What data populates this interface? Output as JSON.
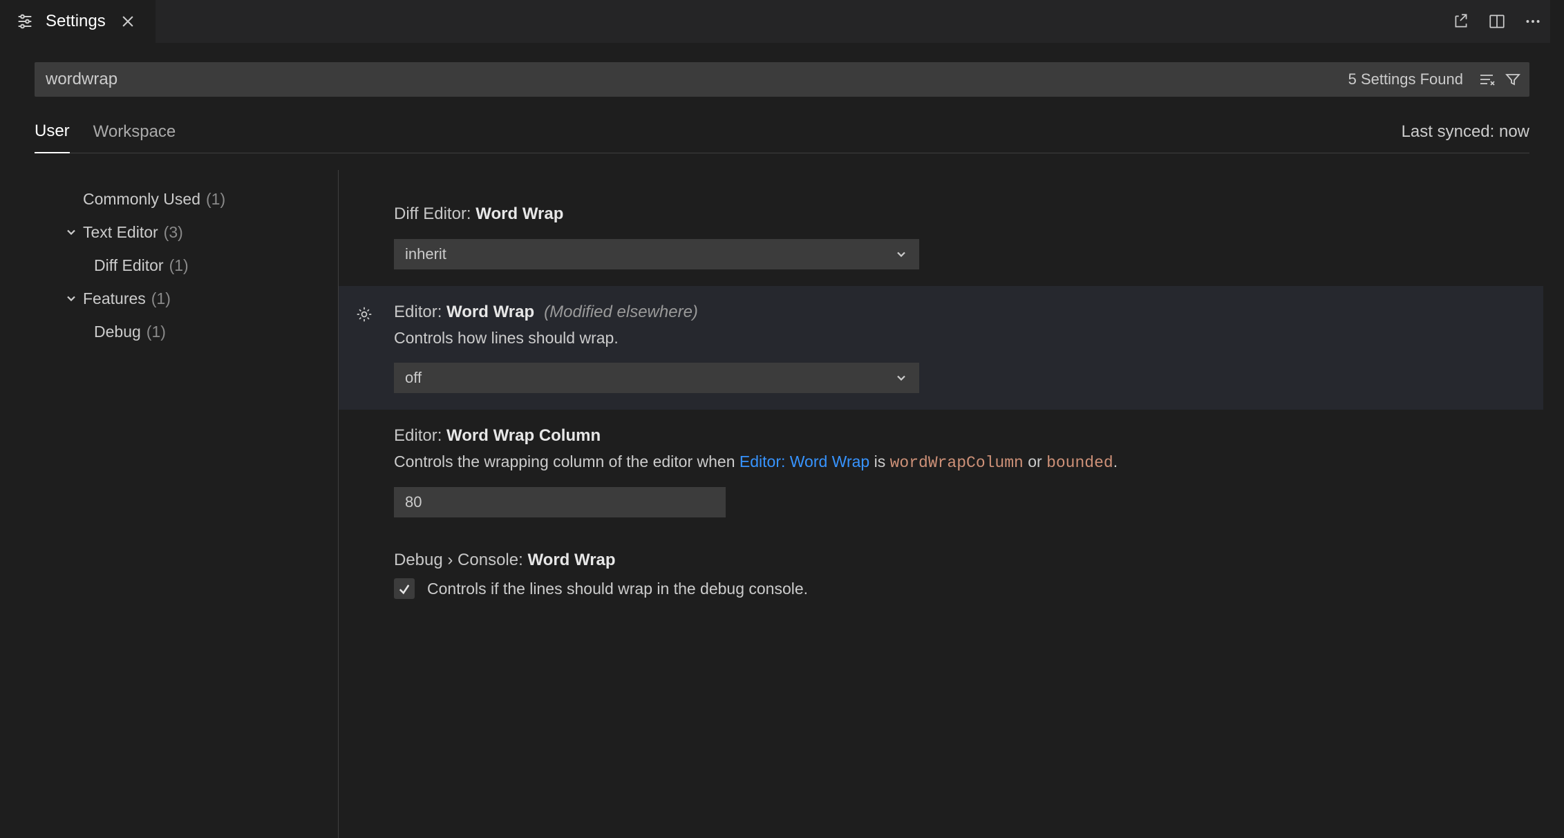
{
  "tab": {
    "title": "Settings"
  },
  "search": {
    "value": "wordwrap",
    "count_label": "5 Settings Found"
  },
  "scope": {
    "user": "User",
    "workspace": "Workspace",
    "sync": "Last synced: now"
  },
  "toc": {
    "commonly_used": {
      "label": "Commonly Used",
      "count": "(1)"
    },
    "text_editor": {
      "label": "Text Editor",
      "count": "(3)"
    },
    "diff_editor": {
      "label": "Diff Editor",
      "count": "(1)"
    },
    "features": {
      "label": "Features",
      "count": "(1)"
    },
    "debug": {
      "label": "Debug",
      "count": "(1)"
    }
  },
  "settings": {
    "diff_word_wrap": {
      "prefix": "Diff Editor: ",
      "name": "Word Wrap",
      "value": "inherit"
    },
    "editor_word_wrap": {
      "prefix": "Editor: ",
      "name": "Word Wrap",
      "meta": "(Modified elsewhere)",
      "desc": "Controls how lines should wrap.",
      "value": "off"
    },
    "editor_word_wrap_column": {
      "prefix": "Editor: ",
      "name": "Word Wrap Column",
      "desc_pre": "Controls the wrapping column of the editor when ",
      "desc_link": "Editor: Word Wrap",
      "desc_mid1": " is ",
      "desc_code1": "wordWrapColumn",
      "desc_mid2": " or ",
      "desc_code2": "bounded",
      "desc_post": ".",
      "value": "80"
    },
    "debug_console_word_wrap": {
      "prefix": "Debug › Console: ",
      "name": "Word Wrap",
      "checked": true,
      "desc": "Controls if the lines should wrap in the debug console."
    }
  }
}
